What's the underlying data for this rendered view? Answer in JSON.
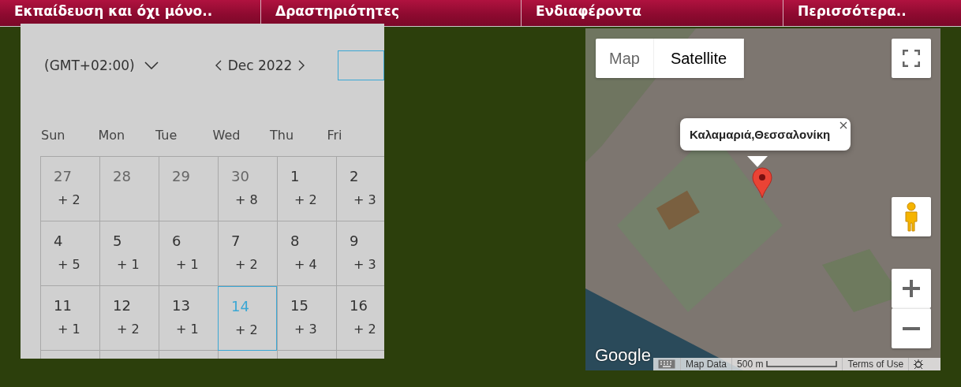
{
  "nav": {
    "items": [
      {
        "label": "Εκπαίδευση και όχι μόνο.."
      },
      {
        "label": "Δραστηριότητες"
      },
      {
        "label": "Ενδιαφέροντα"
      },
      {
        "label": "Περισσότερα.."
      }
    ]
  },
  "calendar": {
    "timezone": "(GMT+02:00)",
    "month": "Dec 2022",
    "weekdays": [
      "Sun",
      "Mon",
      "Tue",
      "Wed",
      "Thu",
      "Fri"
    ],
    "weeks": [
      [
        {
          "day": "27",
          "count": "+ 2",
          "outside_month": true,
          "selected": false
        },
        {
          "day": "28",
          "outside_month": true,
          "selected": false
        },
        {
          "day": "29",
          "outside_month": true,
          "selected": false
        },
        {
          "day": "30",
          "count": "+ 8",
          "outside_month": true,
          "selected": false
        },
        {
          "day": "1",
          "count": "+ 2",
          "outside_month": false,
          "selected": false
        },
        {
          "day": "2",
          "count": "+ 3",
          "outside_month": false,
          "selected": false
        }
      ],
      [
        {
          "day": "4",
          "count": "+ 5",
          "outside_month": false,
          "selected": false
        },
        {
          "day": "5",
          "count": "+ 1",
          "outside_month": false,
          "selected": false
        },
        {
          "day": "6",
          "count": "+ 1",
          "outside_month": false,
          "selected": false
        },
        {
          "day": "7",
          "count": "+ 2",
          "outside_month": false,
          "selected": false
        },
        {
          "day": "8",
          "count": "+ 4",
          "outside_month": false,
          "selected": false
        },
        {
          "day": "9",
          "count": "+ 3",
          "outside_month": false,
          "selected": false
        }
      ],
      [
        {
          "day": "11",
          "count": "+ 1",
          "outside_month": false,
          "selected": false
        },
        {
          "day": "12",
          "count": "+ 2",
          "outside_month": false,
          "selected": false
        },
        {
          "day": "13",
          "count": "+ 1",
          "outside_month": false,
          "selected": false
        },
        {
          "day": "14",
          "count": "+ 2",
          "outside_month": false,
          "selected": true
        },
        {
          "day": "15",
          "count": "+ 3",
          "outside_month": false,
          "selected": false
        },
        {
          "day": "16",
          "count": "+ 2",
          "outside_month": false,
          "selected": false
        }
      ]
    ]
  },
  "map": {
    "type_tabs": [
      {
        "label": "Map",
        "selected": false
      },
      {
        "label": "Satellite",
        "selected": true
      }
    ],
    "info_window": {
      "title": "Καλαμαριά,Θεσσαλονίκη"
    },
    "logo": "Google",
    "footer": {
      "map_data": "Map Data",
      "scale": "500 m",
      "terms": "Terms of Use"
    }
  }
}
